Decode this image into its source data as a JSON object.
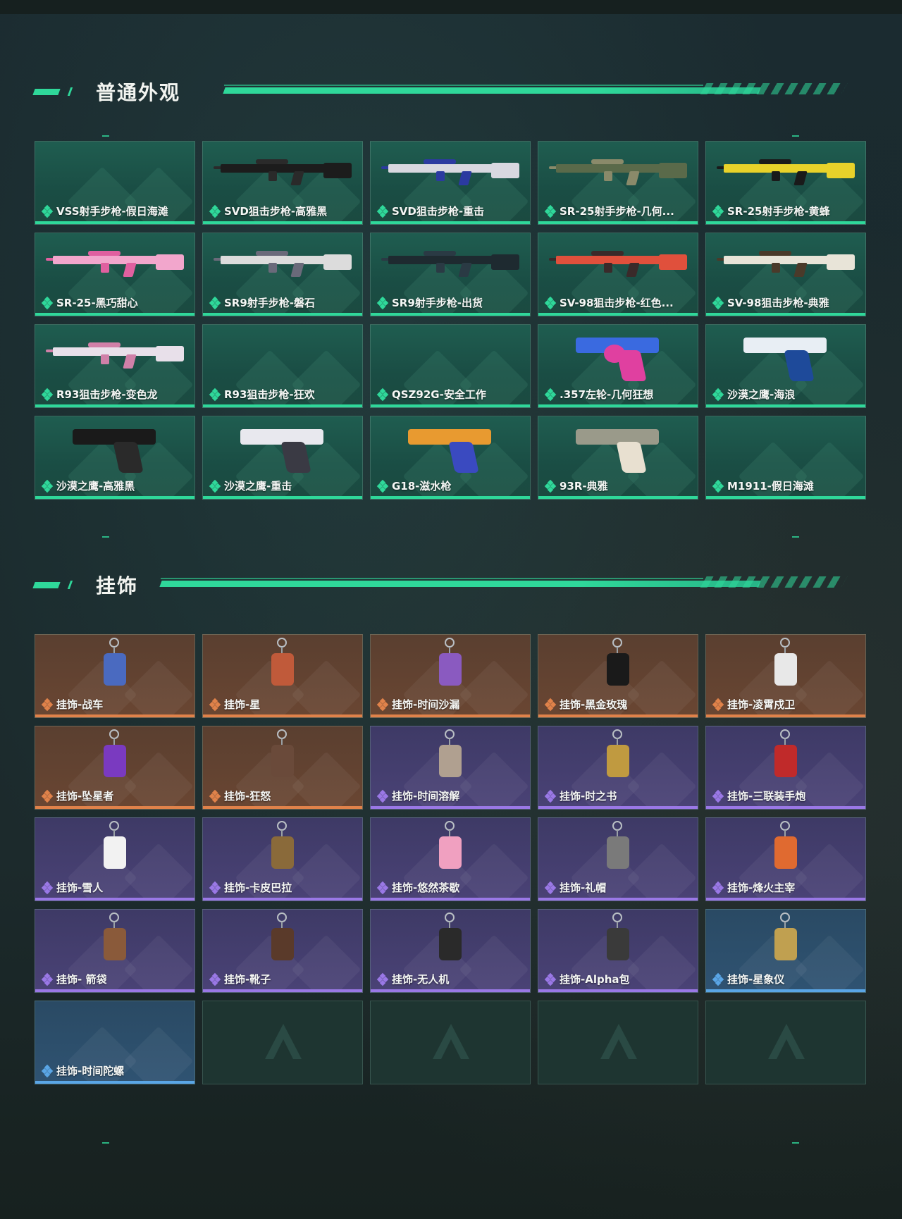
{
  "sections": {
    "skins": {
      "title": "普通外观"
    },
    "charms": {
      "title": "挂饰"
    }
  },
  "colors": {
    "accent": "#2fd89a",
    "rarity_green": "#2fd89a",
    "rarity_orange": "#e0824a",
    "rarity_purple": "#9a78e6",
    "rarity_blue": "#5aa6e6"
  },
  "skins": [
    {
      "label": "VSS射手步枪-假日海滩",
      "kind": "empty-art"
    },
    {
      "label": "SVD狙击步枪-高雅黑",
      "kind": "rifle",
      "c1": "#1c1c1c",
      "c2": "#2a2a2a"
    },
    {
      "label": "SVD狙击步枪-重击",
      "kind": "rifle",
      "c1": "#d8d8e0",
      "c2": "#2b3aa0"
    },
    {
      "label": "SR-25射手步枪-几何...",
      "kind": "rifle",
      "c1": "#5a6a4a",
      "c2": "#8a8a6a"
    },
    {
      "label": "SR-25射手步枪-黄蜂",
      "kind": "rifle",
      "c1": "#e8d22a",
      "c2": "#1a1a1a"
    },
    {
      "label": "SR-25-黑巧甜心",
      "kind": "rifle",
      "c1": "#f2a6cc",
      "c2": "#e060a0"
    },
    {
      "label": "SR9射手步枪-磐石",
      "kind": "rifle",
      "c1": "#dcdcdc",
      "c2": "#6a6a7a"
    },
    {
      "label": "SR9射手步枪-出货",
      "kind": "rifle",
      "c1": "#1e2a30",
      "c2": "#2a3a44"
    },
    {
      "label": "SV-98狙击步枪-红色...",
      "kind": "rifle",
      "c1": "#e0503c",
      "c2": "#3a2a2a"
    },
    {
      "label": "SV-98狙击步枪-典雅",
      "kind": "rifle",
      "c1": "#e8e4d8",
      "c2": "#4a3a2a"
    },
    {
      "label": "R93狙击步枪-变色龙",
      "kind": "rifle",
      "c1": "#e8e0ea",
      "c2": "#d080a8"
    },
    {
      "label": "R93狙击步枪-狂欢",
      "kind": "empty-art"
    },
    {
      "label": "QSZ92G-安全工作",
      "kind": "empty-art"
    },
    {
      "label": ".357左轮-几何狂想",
      "kind": "revolver",
      "c1": "#3a6ae0",
      "c2": "#e040a0"
    },
    {
      "label": "沙漠之鹰-海浪",
      "kind": "pistol",
      "c1": "#e8eef4",
      "c2": "#1e4a9a"
    },
    {
      "label": "沙漠之鹰-高雅黑",
      "kind": "pistol",
      "c1": "#1a1a1a",
      "c2": "#2a2a2a"
    },
    {
      "label": "沙漠之鹰-重击",
      "kind": "pistol",
      "c1": "#e8e8ee",
      "c2": "#3a3a44"
    },
    {
      "label": "G18-滋水枪",
      "kind": "pistol",
      "c1": "#e89a30",
      "c2": "#3a4ac0"
    },
    {
      "label": "93R-典雅",
      "kind": "pistol",
      "c1": "#9a9a8a",
      "c2": "#e8e0d0"
    },
    {
      "label": "M1911-假日海滩",
      "kind": "empty-art"
    }
  ],
  "charms": [
    {
      "label": "挂饰-战车",
      "rarity": "orange",
      "color": "#4a6ac0"
    },
    {
      "label": "挂饰-星",
      "rarity": "orange",
      "color": "#c05a3a"
    },
    {
      "label": "挂饰-时间沙漏",
      "rarity": "orange",
      "color": "#8a5ac0"
    },
    {
      "label": "挂饰-黑金玫瑰",
      "rarity": "orange",
      "color": "#1a1a1a"
    },
    {
      "label": "挂饰-凌霄戍卫",
      "rarity": "orange",
      "color": "#e8e8e8"
    },
    {
      "label": "挂饰-坠星者",
      "rarity": "orange",
      "color": "#7a3ac0"
    },
    {
      "label": "挂饰-狂怒",
      "rarity": "orange",
      "color": "#6a4a3a"
    },
    {
      "label": "挂饰-时间溶解",
      "rarity": "purple",
      "color": "#b0a090"
    },
    {
      "label": "挂饰-时之书",
      "rarity": "purple",
      "color": "#c09a40"
    },
    {
      "label": "挂饰-三联装手炮",
      "rarity": "purple",
      "color": "#c02a2a"
    },
    {
      "label": "挂饰-雪人",
      "rarity": "purple",
      "color": "#f2f2f2"
    },
    {
      "label": "挂饰-卡皮巴拉",
      "rarity": "purple",
      "color": "#8a6a3a"
    },
    {
      "label": "挂饰-悠然茶歇",
      "rarity": "purple",
      "color": "#f0a0c0"
    },
    {
      "label": "挂饰-礼帽",
      "rarity": "purple",
      "color": "#7a7a7a"
    },
    {
      "label": "挂饰-烽火主宰",
      "rarity": "purple",
      "color": "#e06a30"
    },
    {
      "label": "挂饰- 箭袋",
      "rarity": "purple",
      "color": "#8a5a3a"
    },
    {
      "label": "挂饰-靴子",
      "rarity": "purple",
      "color": "#5a3a2a"
    },
    {
      "label": "挂饰-无人机",
      "rarity": "purple",
      "color": "#2a2a2a"
    },
    {
      "label": "挂饰-Alpha包",
      "rarity": "purple",
      "color": "#3a3a3a"
    },
    {
      "label": "挂饰-星象仪",
      "rarity": "blue",
      "color": "#c0a050"
    },
    {
      "label": "挂饰-时间陀螺",
      "rarity": "blue",
      "color": ""
    }
  ],
  "empty_slots": 4
}
